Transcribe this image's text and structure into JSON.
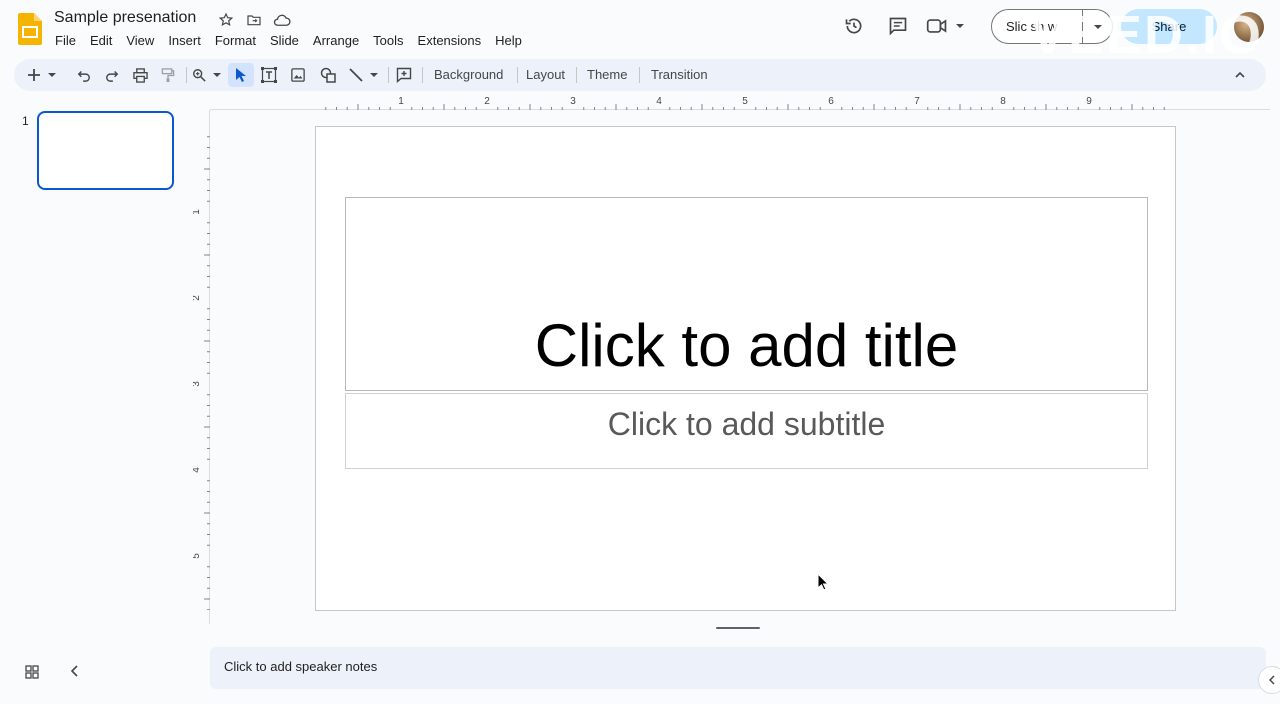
{
  "app": {
    "doc_title": "Sample presenation",
    "colors": {
      "accent": "#0b57d0",
      "share_bg": "#c2e7ff",
      "logo": "#f4b400"
    }
  },
  "menu": [
    "File",
    "Edit",
    "View",
    "Insert",
    "Format",
    "Slide",
    "Arrange",
    "Tools",
    "Extensions",
    "Help"
  ],
  "header": {
    "slideshow_label": "Slic  sh  w",
    "share_label": "Share",
    "watermark": "VEED.IO",
    "icons": [
      "star-icon",
      "move-to-folder-icon",
      "cloud-saved-icon",
      "history-icon",
      "comments-icon",
      "meet-camera-icon",
      "chevron-down-icon"
    ]
  },
  "toolbar": {
    "background": "Background",
    "layout": "Layout",
    "theme": "Theme",
    "transition": "Transition",
    "icons": [
      "new-slide-icon",
      "undo-icon",
      "redo-icon",
      "print-icon",
      "paint-format-icon",
      "zoom-icon",
      "select-icon",
      "text-box-icon",
      "image-icon",
      "shape-icon",
      "line-icon",
      "comment-add-icon",
      "collapse-toolbar-icon"
    ]
  },
  "filmstrip": {
    "slide_numbers": [
      "1"
    ]
  },
  "ruler": {
    "h_labels": [
      "1",
      "2",
      "3",
      "4",
      "5",
      "6",
      "7",
      "8",
      "9"
    ],
    "v_labels": [
      "1",
      "2",
      "3",
      "4",
      "5"
    ]
  },
  "slide": {
    "title_placeholder": "Click to add title",
    "subtitle_placeholder": "Click to add subtitle"
  },
  "notes": {
    "placeholder": "Click to add speaker notes"
  }
}
